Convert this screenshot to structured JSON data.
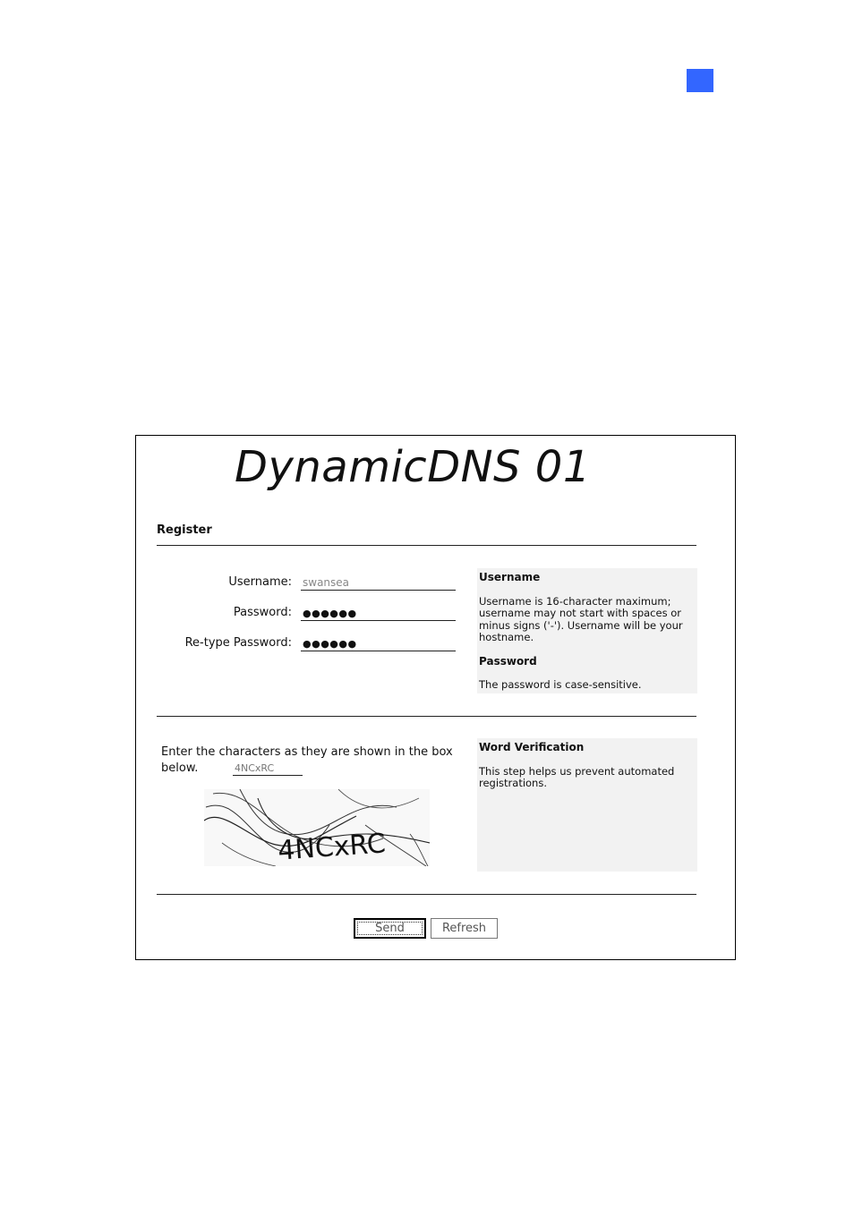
{
  "page": {
    "marker_color": "#3366ff"
  },
  "logo": {
    "text": "DynamicDNS 01"
  },
  "register": {
    "title": "Register",
    "username_label": "Username:",
    "username_value": "swansea",
    "password_label": "Password:",
    "password_value": "●●●●●●",
    "retype_label": "Re-type Password:",
    "retype_value": "●●●●●●"
  },
  "help": {
    "username_heading": "Username",
    "username_text": "Username is 16-character maximum; username may not start with spaces or minus signs ('-'). Username will be your hostname.",
    "password_heading": "Password",
    "password_text": "The password is case-sensitive."
  },
  "verification": {
    "prompt": "Enter the characters as they are shown in the box below.",
    "code_value": "4NCxRC",
    "captcha_text": "4NCxRC",
    "heading": "Word Verification",
    "text": "This step helps us prevent automated registrations."
  },
  "buttons": {
    "send": "Send",
    "refresh": "Refresh"
  },
  "icons": {
    "captcha": "captcha-image"
  }
}
